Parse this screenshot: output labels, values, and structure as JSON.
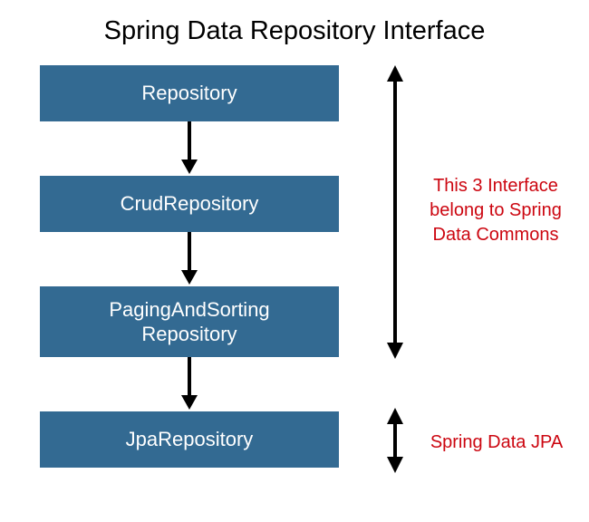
{
  "title": "Spring Data Repository Interface",
  "boxes": {
    "repository": "Repository",
    "crud": "CrudRepository",
    "paging_line1": "PagingAndSorting",
    "paging_line2": "Repository",
    "jpa": "JpaRepository"
  },
  "annotations": {
    "commons_line1": "This 3 Interface",
    "commons_line2": "belong to Spring",
    "commons_line3": "Data Commons",
    "jpa": "Spring Data JPA"
  }
}
